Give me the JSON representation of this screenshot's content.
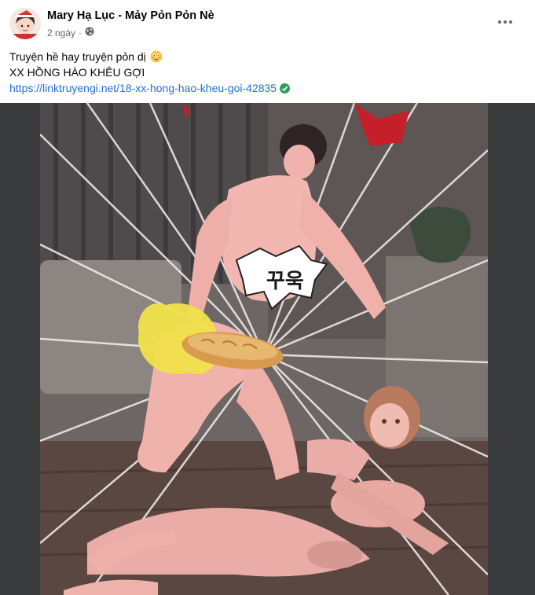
{
  "post": {
    "author": "Mary Hạ Lục - Mảy Pỏn Pỏn Nè",
    "time": "2 ngày",
    "privacy_icon": "globe-icon",
    "caption_line1": "Truyện hề hay truyện pỏn dị",
    "caption_emoji": "flushed-face-emoji",
    "caption_line2": "XX HỒNG HÀO KHÊU GỢI",
    "link": "https://linktruyengi.net/18-xx-hong-hao-kheu-goi-42835",
    "link_badge": "verified-check-icon"
  },
  "media": {
    "speech_bubble_text": "꾸욱"
  },
  "colors": {
    "link": "#216fdb",
    "meta": "#65676b",
    "verified": "#2e9e5b",
    "media_frame": "#3a3b3c"
  }
}
